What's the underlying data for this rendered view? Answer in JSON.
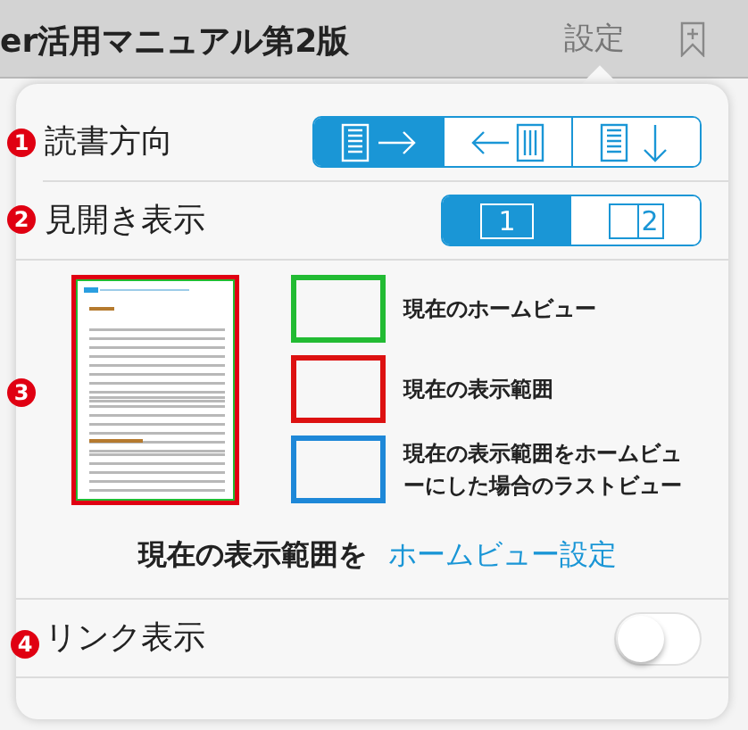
{
  "header": {
    "title": "er活用マニュアル第2版",
    "settings_tab": "設定"
  },
  "reading_direction": {
    "badge": "1",
    "label": "読書方向",
    "options": [
      {
        "kind": "horizontal",
        "selected": true
      },
      {
        "kind": "vertical_left",
        "selected": false
      },
      {
        "kind": "vertical_down",
        "selected": false
      }
    ]
  },
  "spread": {
    "badge": "2",
    "label": "見開き表示",
    "options": [
      {
        "kind": "single",
        "text": "1",
        "selected": true
      },
      {
        "kind": "double",
        "text": "2",
        "selected": false
      }
    ]
  },
  "home_view": {
    "badge": "3",
    "legend": [
      {
        "color": "#22bb33",
        "label": "現在のホームビュー"
      },
      {
        "color": "#dd1111",
        "label": "現在の表示範囲"
      },
      {
        "color": "#1e88d8",
        "label": "現在の表示範囲をホームビューにした場合のラストビュー"
      }
    ],
    "action_text": "現在の表示範囲を",
    "action_link": "ホームビュー設定"
  },
  "link_display": {
    "badge": "4",
    "label": "リンク表示",
    "on": false
  }
}
